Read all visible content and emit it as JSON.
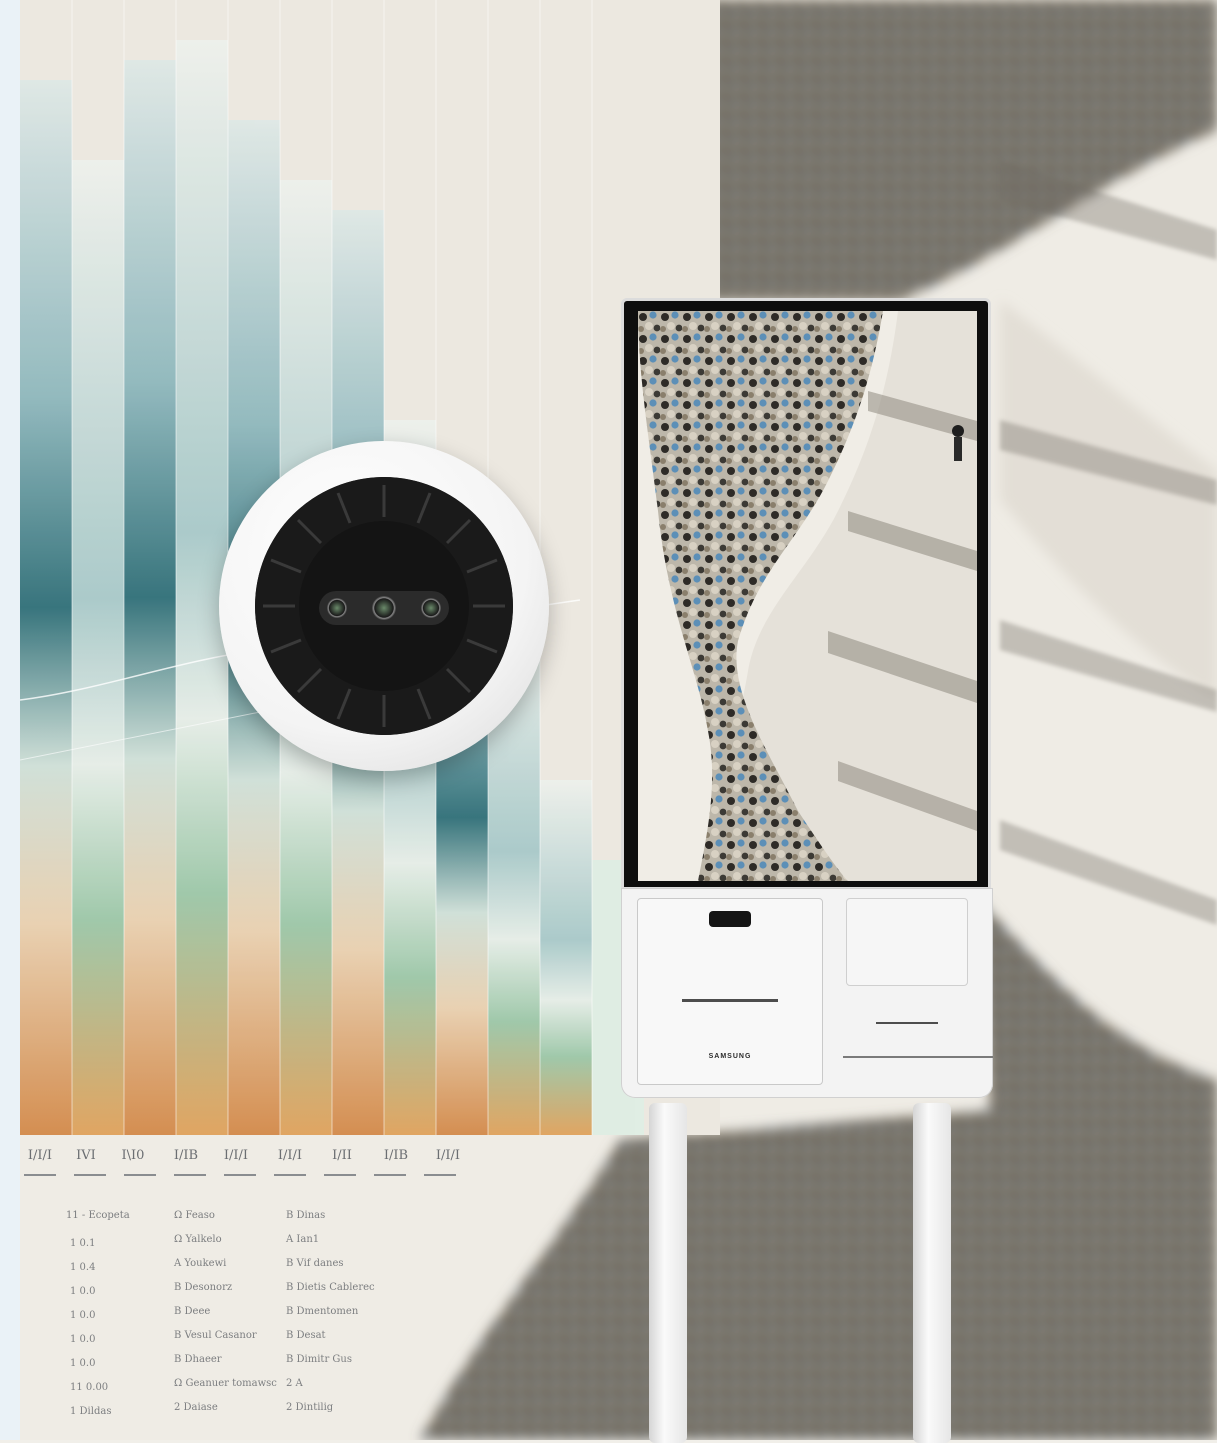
{
  "kiosk": {
    "brand": "SAMSUNG"
  },
  "chart_axis": {
    "ticks": [
      "I/I/I",
      "IVI",
      "I\\I0",
      "I/IB",
      "I/I/I",
      "I/I/I",
      "I/II",
      "I/IB",
      "I/I/I"
    ]
  },
  "table_rows": [
    [
      "11 - Ecopeta",
      "Ω  Feaso",
      "B  Dinas"
    ],
    [
      "1  0.1",
      "Ω  Yalkelo",
      "A  Ian1"
    ],
    [
      "1  0.4",
      "A  Youkewi",
      "B  Vif danes"
    ],
    [
      "1  0.0",
      "B  Desonorz",
      "B  Dietis Cablerec"
    ],
    [
      "1  0.0",
      "B  Deee",
      "B  Dmentomen"
    ],
    [
      "1  0.0",
      "B  Vesul Casanor",
      "B  Desat"
    ],
    [
      "1  0.0",
      "B  Dhaeer",
      "B  Dimitr Gus"
    ],
    [
      "11  0.00",
      "Ω  Geanuer tomawsc",
      "2  A"
    ],
    [
      "1  Dildas",
      "2  Daiase",
      "2  Dintilig"
    ]
  ]
}
